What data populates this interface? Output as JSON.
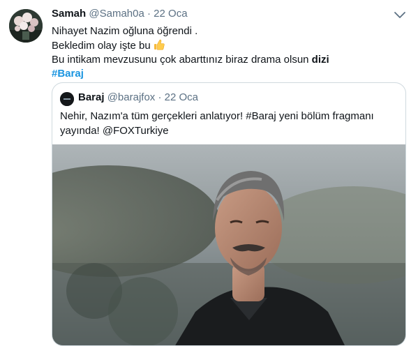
{
  "tweet": {
    "author_name": "Samah",
    "author_handle": "@Samah0a",
    "separator": "·",
    "date": "22 Oca",
    "lines": [
      "Nihayet Nazim oğluna öğrendi .",
      "Bekledim olay işte bu",
      "Bu intikam mevzusunu çok abarttınız biraz drama olsun ",
      "dizi",
      "#Baraj"
    ],
    "emoji": "thumbs-up"
  },
  "quoted_tweet": {
    "author_name": "Baraj",
    "author_handle": "@barajfox",
    "separator": "·",
    "date": "22 Oca",
    "text": "Nehir, Nazım'a tüm gerçekleri anlatıyor! #Baraj yeni bölüm fragmanı yayında! @FOXTurkiye",
    "media_icon": "video-thumbnail"
  },
  "colors": {
    "text": "#0f1419",
    "secondary": "#5b7083",
    "hashtag": "#1b95e0",
    "border": "#cfd9de"
  }
}
